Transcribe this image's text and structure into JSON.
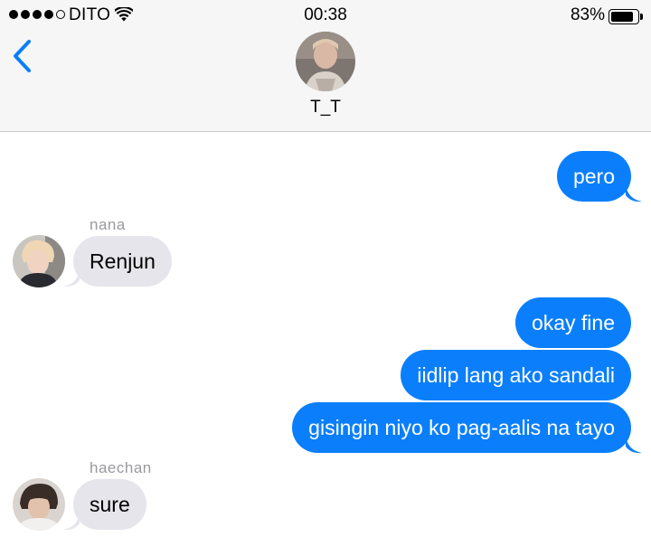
{
  "status_bar": {
    "carrier": "DITO",
    "time": "00:38",
    "battery_percent": "83%",
    "signal_bars_filled": 4,
    "signal_bars_total": 5
  },
  "conversation": {
    "title": "T_T"
  },
  "messages": [
    {
      "direction": "outgoing",
      "text": "pero"
    },
    {
      "direction": "incoming",
      "sender": "nana",
      "text": "Renjun"
    },
    {
      "direction": "outgoing",
      "text": "okay fine"
    },
    {
      "direction": "outgoing",
      "text": "iidlip lang ako sandali"
    },
    {
      "direction": "outgoing",
      "text": "gisingin niyo ko pag-aalis na tayo"
    },
    {
      "direction": "incoming",
      "sender": "haechan",
      "text": "sure"
    }
  ],
  "colors": {
    "outgoing_bubble": "#0b7ffb",
    "incoming_bubble": "#e6e5eb",
    "accent": "#0b7ffb",
    "sender_label": "#9a9a9e"
  },
  "icons": {
    "back": "chevron-left-icon",
    "wifi": "wifi-icon",
    "battery": "battery-icon"
  }
}
